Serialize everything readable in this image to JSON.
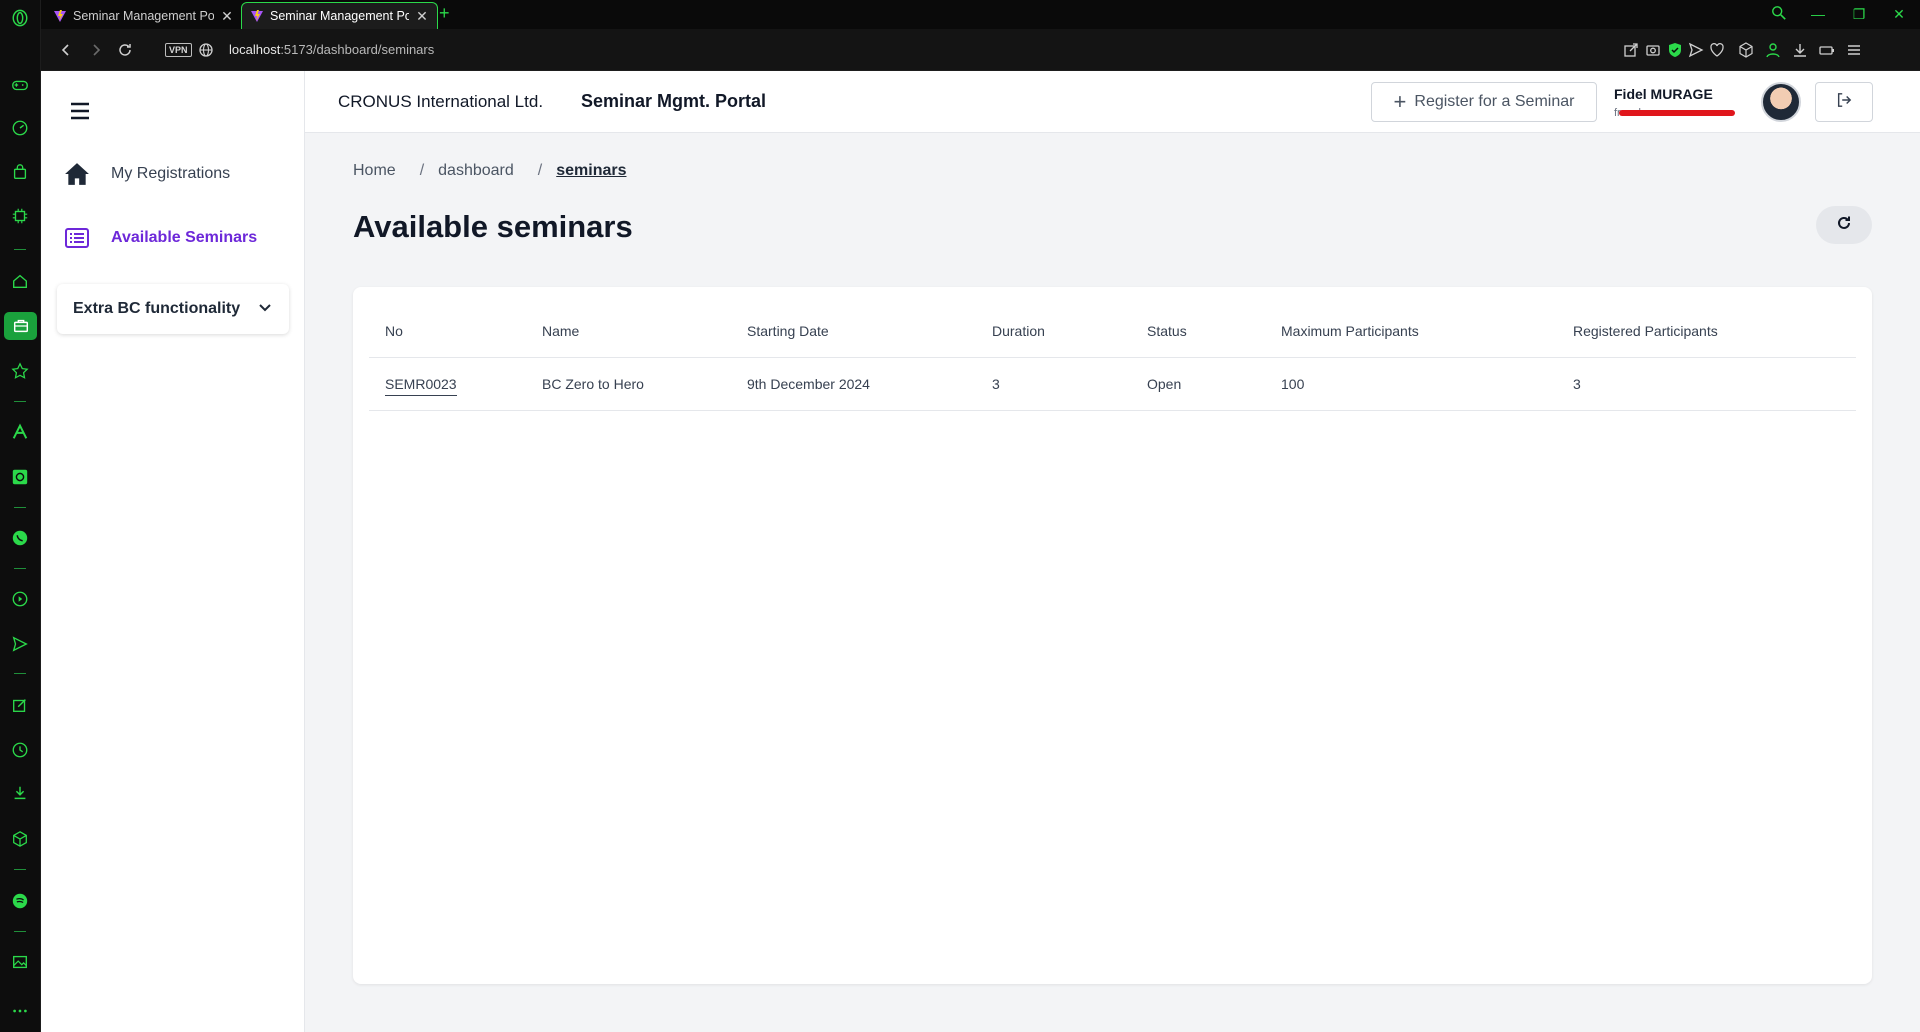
{
  "browser": {
    "tabs": [
      {
        "title": "Seminar Management Port",
        "active": false
      },
      {
        "title": "Seminar Management Port",
        "active": true
      }
    ],
    "vpn_label": "VPN",
    "url_host": "localhost",
    "url_path": ":5173/dashboard/seminars",
    "accent_color": "#2bd94a"
  },
  "sidebar": {
    "items": [
      {
        "label": "My Registrations",
        "icon": "home-icon"
      },
      {
        "label": "Available Seminars",
        "icon": "list-icon",
        "active": true
      }
    ],
    "group_label": "Extra BC functionality"
  },
  "header": {
    "company": "CRONUS International Ltd.",
    "portal": "Seminar Mgmt. Portal",
    "register_label": "Register for a Seminar",
    "user_name": "Fidel MURAGE",
    "user_email_visible": "fr          co.ke"
  },
  "breadcrumb": {
    "home": "Home",
    "dashboard": "dashboard",
    "current": "seminars",
    "separator": "/"
  },
  "page": {
    "title": "Available seminars",
    "accent_color": "#6d28d9"
  },
  "table": {
    "columns": [
      "No",
      "Name",
      "Starting Date",
      "Duration",
      "Status",
      "Maximum Participants",
      "Registered Participants"
    ],
    "rows": [
      {
        "no": "SEMR0023",
        "name": "BC Zero to Hero",
        "starting_date": "9th December 2024",
        "duration": "3",
        "status": "Open",
        "max_participants": "100",
        "registered_participants": "3"
      }
    ]
  }
}
